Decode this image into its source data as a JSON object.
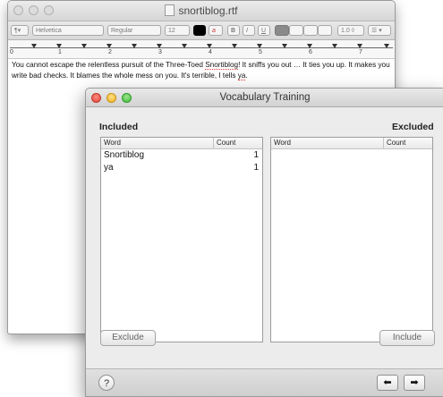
{
  "back_window": {
    "title": "snortiblog.rtf",
    "toolbar": {
      "paragraph": "¶▾",
      "font": "Helvetica",
      "style": "Regular",
      "size": "12",
      "bold": "B",
      "italic": "I",
      "underline": "U",
      "spacing": "1.0 ◊",
      "list": "☰ ▾"
    },
    "ruler": [
      "0",
      "1",
      "2",
      "3",
      "4",
      "5",
      "6",
      "7"
    ],
    "text": {
      "p1": "You cannot escape the relentless pursuit of the Three-Toed ",
      "p2": "Snortiblog",
      "p3": "! It sniffs you out … It ties you up. It makes you write bad checks. It blames the whole mess on you. It's terrible, I tells ",
      "p4": "ya",
      "p5": "."
    }
  },
  "dialog": {
    "title": "Vocabulary Training",
    "included_label": "Included",
    "excluded_label": "Excluded",
    "columns": {
      "word": "Word",
      "count": "Count"
    },
    "included_rows": [
      {
        "word": "Snortiblog",
        "count": "1"
      },
      {
        "word": "ya",
        "count": "1"
      }
    ],
    "exclude_button": "Exclude",
    "include_button": "Include",
    "help": "?",
    "prev": "⬅",
    "next": "➡"
  }
}
